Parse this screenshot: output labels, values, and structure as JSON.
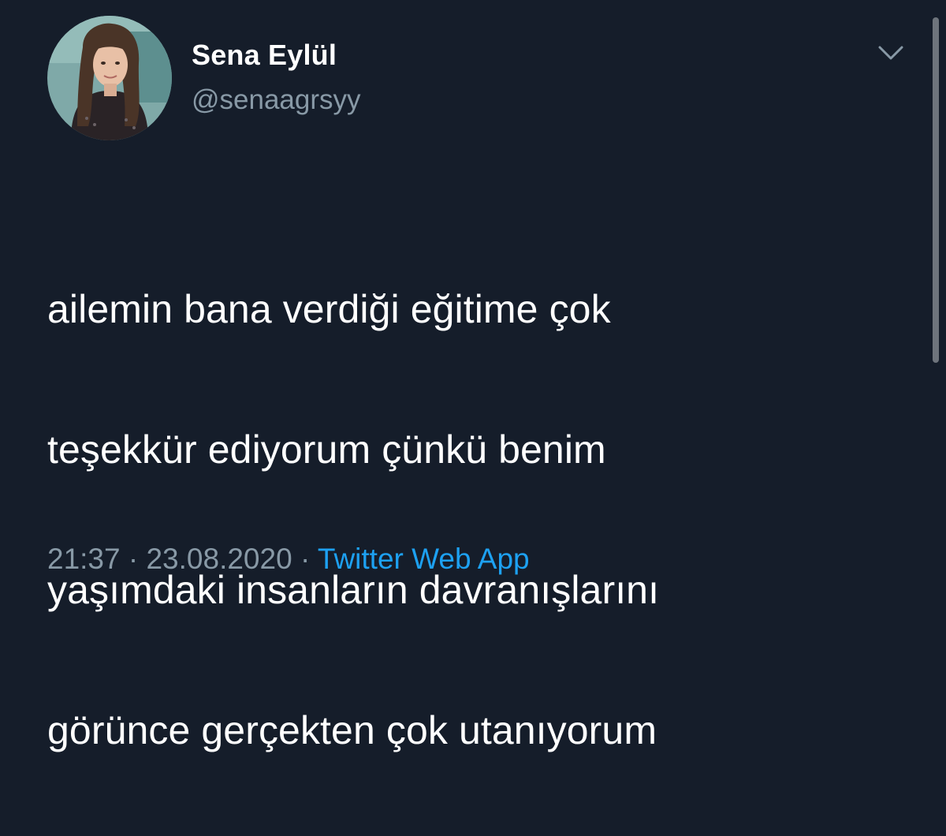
{
  "user": {
    "display_name": "Sena Eylül",
    "handle": "@senaagrsyy"
  },
  "icons": {
    "menu": "chevron-down-icon",
    "avatar": "profile-photo"
  },
  "tweet": {
    "lines": [
      "ailemin bana verdiği eğitime çok",
      "teşekkür ediyorum çünkü benim",
      "yaşımdaki insanların davranışlarını",
      "görünce gerçekten çok utanıyorum"
    ]
  },
  "meta": {
    "time": "21:37",
    "separator": "·",
    "date": "23.08.2020",
    "source": "Twitter Web App"
  },
  "colors": {
    "background": "#151d2a",
    "text": "#ffffff",
    "muted": "#8899a6",
    "link": "#1da1f2"
  }
}
